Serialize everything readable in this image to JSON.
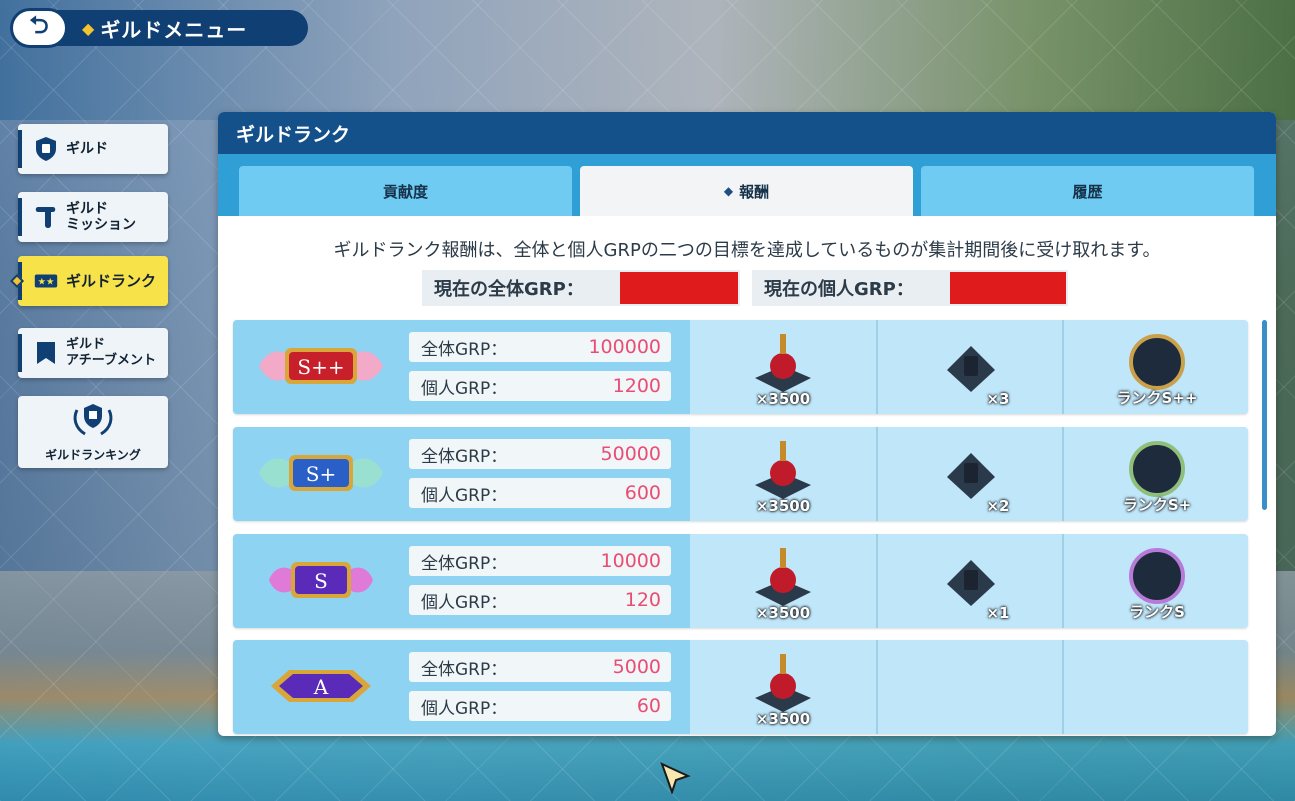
{
  "header": {
    "title": "ギルドメニュー"
  },
  "sidebar": {
    "items": [
      {
        "label": "ギルド"
      },
      {
        "label_line1": "ギルド",
        "label_line2": "ミッション"
      },
      {
        "label": "ギルドランク"
      },
      {
        "label_line1": "ギルド",
        "label_line2": "アチーブメント"
      },
      {
        "label": "ギルドランキング"
      }
    ]
  },
  "panel": {
    "title": "ギルドランク",
    "tabs": [
      "貢献度",
      "報酬",
      "履歴"
    ],
    "active_tab": "報酬",
    "info": "ギルドランク報酬は、全体と個人GRPの二つの目標を達成しているものが集計期間後に受け取れます。",
    "current_total_label": "現在の全体GRP：",
    "current_personal_label": "現在の個人GRP："
  },
  "ranks": [
    {
      "badge": "S++",
      "total_label": "全体GRP：",
      "total": "100000",
      "personal_label": "個人GRP：",
      "personal": "1200",
      "rewards": [
        "×3500",
        "×3",
        "ランクS++"
      ]
    },
    {
      "badge": "S+",
      "total_label": "全体GRP：",
      "total": "50000",
      "personal_label": "個人GRP：",
      "personal": "600",
      "rewards": [
        "×3500",
        "×2",
        "ランクS+"
      ]
    },
    {
      "badge": "S",
      "total_label": "全体GRP：",
      "total": "10000",
      "personal_label": "個人GRP：",
      "personal": "120",
      "rewards": [
        "×3500",
        "×1",
        "ランクS"
      ]
    },
    {
      "badge": "A",
      "total_label": "全体GRP：",
      "total": "5000",
      "personal_label": "個人GRP：",
      "personal": "60",
      "rewards": [
        "×3500"
      ]
    }
  ],
  "colors": {
    "accent": "#0f3f73",
    "highlight": "#f8e24a",
    "value": "#ea4d74",
    "redact": "#e01b1b"
  }
}
